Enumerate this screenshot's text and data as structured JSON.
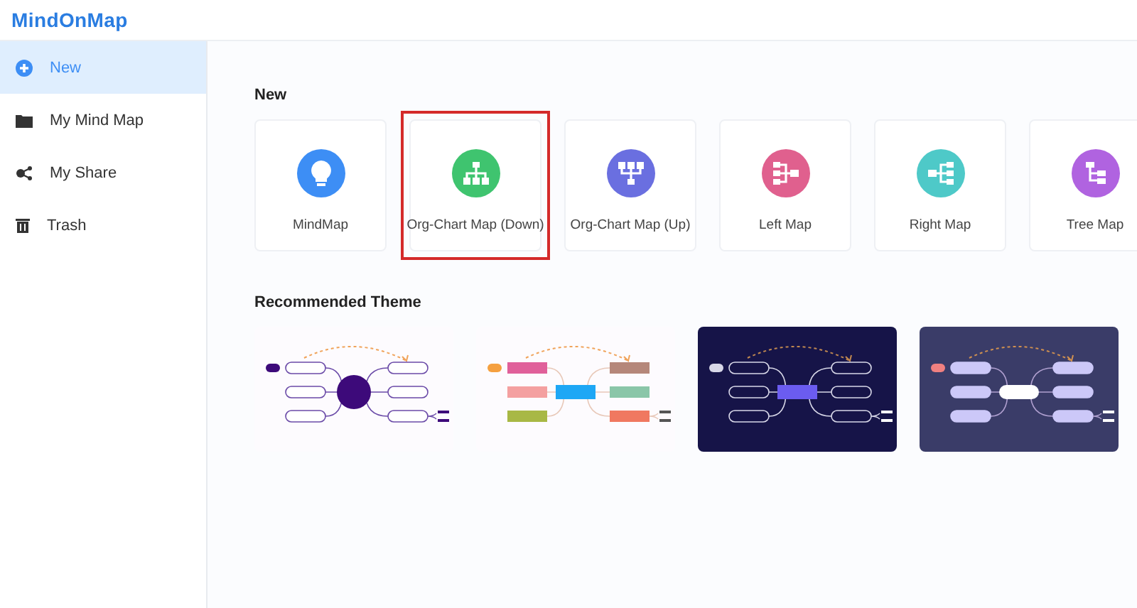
{
  "app": {
    "logo": "MindOnMap"
  },
  "sidebar": {
    "items": [
      {
        "label": "New",
        "kind": "plus",
        "selected": true
      },
      {
        "label": "My Mind Map",
        "kind": "folder",
        "selected": false
      },
      {
        "label": "My Share",
        "kind": "share",
        "selected": false
      },
      {
        "label": "Trash",
        "kind": "trash",
        "selected": false
      }
    ]
  },
  "new_section": {
    "title": "New",
    "templates": [
      {
        "label": "MindMap",
        "kind": "bulb",
        "color": "#3d8ef5",
        "selected": false
      },
      {
        "label": "Org-Chart Map (Down)",
        "kind": "down",
        "color": "#3fc46f",
        "selected": true
      },
      {
        "label": "Org-Chart Map (Up)",
        "kind": "up",
        "color": "#6a6fe0",
        "selected": false
      },
      {
        "label": "Left Map",
        "kind": "left",
        "color": "#e0608e",
        "selected": false
      },
      {
        "label": "Right Map",
        "kind": "right",
        "color": "#4ec9c8",
        "selected": false
      },
      {
        "label": "Tree Map",
        "kind": "tree",
        "color": "#b063e0",
        "selected": false
      }
    ]
  },
  "themes_section": {
    "title": "Recommended Theme",
    "themes": [
      {
        "kind": "classic"
      },
      {
        "kind": "colorful"
      },
      {
        "kind": "dark"
      },
      {
        "kind": "slate"
      }
    ]
  }
}
